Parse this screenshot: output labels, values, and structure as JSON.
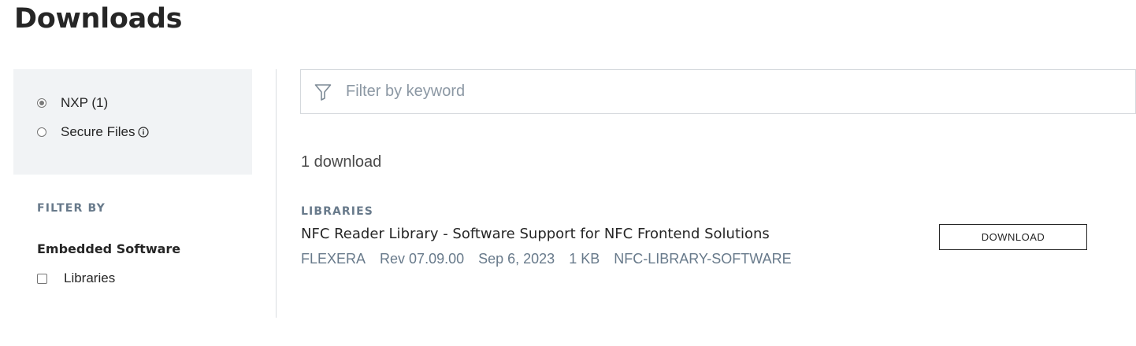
{
  "page": {
    "title": "Downloads"
  },
  "sidebar": {
    "sources": [
      {
        "label": "NXP (1)",
        "checked": true
      },
      {
        "label": "Secure Files",
        "checked": false,
        "icon": "info-icon"
      }
    ],
    "filter_by_heading": "FILTER BY",
    "facets": [
      {
        "title": "Embedded Software",
        "options": [
          {
            "label": "Libraries",
            "checked": false
          }
        ]
      }
    ]
  },
  "search": {
    "placeholder": "Filter by keyword",
    "value": "",
    "icon": "filter-icon"
  },
  "results": {
    "count_text": "1 download",
    "items": [
      {
        "category": "LIBRARIES",
        "title": "NFC Reader Library - Software Support for NFC Frontend Solutions",
        "meta": {
          "vendor": "FLEXERA",
          "revision": "Rev 07.09.00",
          "date": "Sep 6, 2023",
          "size": "1 KB",
          "id": "NFC-LIBRARY-SOFTWARE"
        },
        "action_label": "DOWNLOAD"
      }
    ]
  },
  "colors": {
    "text": "#262626",
    "muted": "#687a8b",
    "panel_bg": "#f1f3f5",
    "border": "#d5d9dd"
  }
}
